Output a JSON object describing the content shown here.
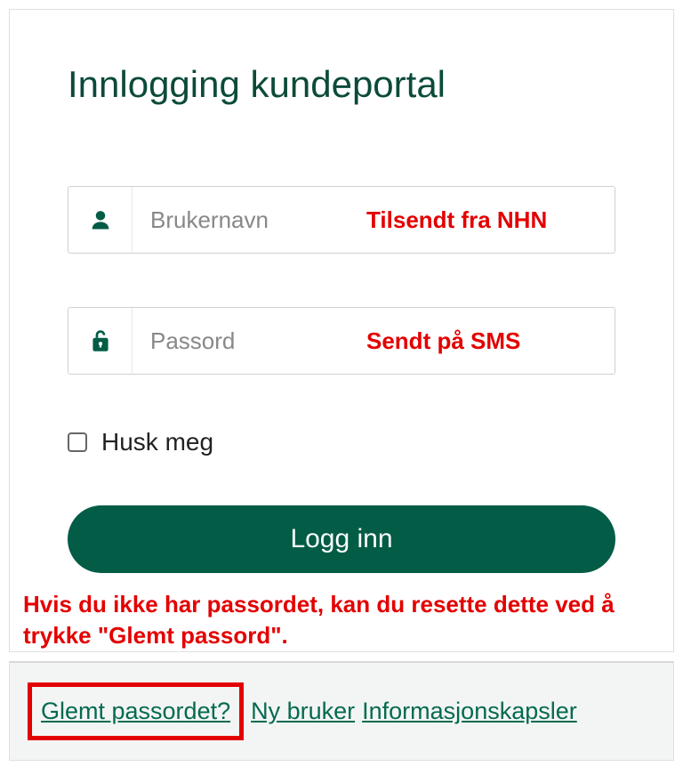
{
  "colors": {
    "brand": "#025c46",
    "annotation_red": "#e30000"
  },
  "header": {
    "title": "Innlogging kundeportal"
  },
  "fields": {
    "username": {
      "placeholder": "Brukernavn",
      "value": "",
      "annotation": "Tilsendt fra NHN"
    },
    "password": {
      "placeholder": "Passord",
      "value": "",
      "annotation": "Sendt på SMS"
    }
  },
  "remember": {
    "label": "Husk meg",
    "checked": false
  },
  "login_button": {
    "label": "Logg inn"
  },
  "instruction_text": "Hvis du ikke har passordet, kan du resette dette ved å trykke \"Glemt passord\".",
  "footer": {
    "forgot_password": "Glemt passordet?",
    "new_user": "Ny bruker",
    "cookies": "Informasjonskapsler"
  }
}
